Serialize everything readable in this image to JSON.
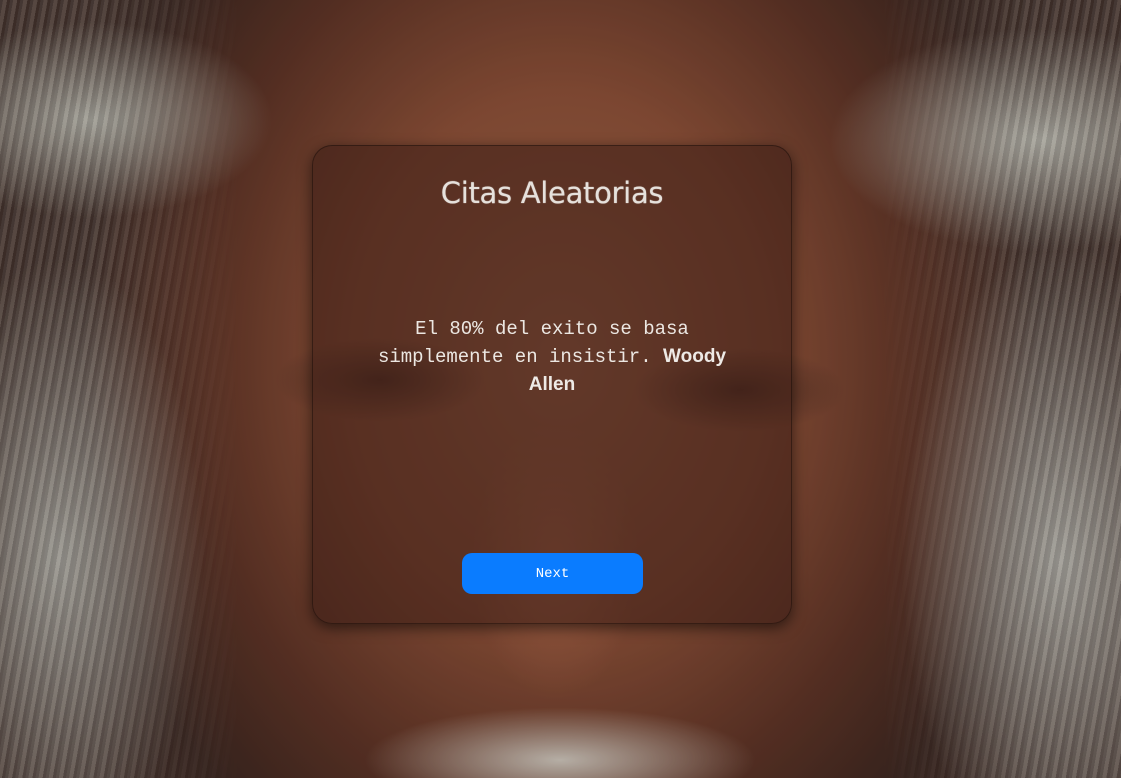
{
  "page": {
    "title": "Citas Aleatorias",
    "quote": {
      "text": "El 80% del exito se basa simplemente en insistir.",
      "author": "Woody Allen"
    },
    "next_label": "Next"
  },
  "colors": {
    "button": "#0a7cff",
    "card": "rgba(60, 30, 22, 0.55)",
    "text": "#ece7e2"
  },
  "background": {
    "description_icon": "portrait-image"
  }
}
